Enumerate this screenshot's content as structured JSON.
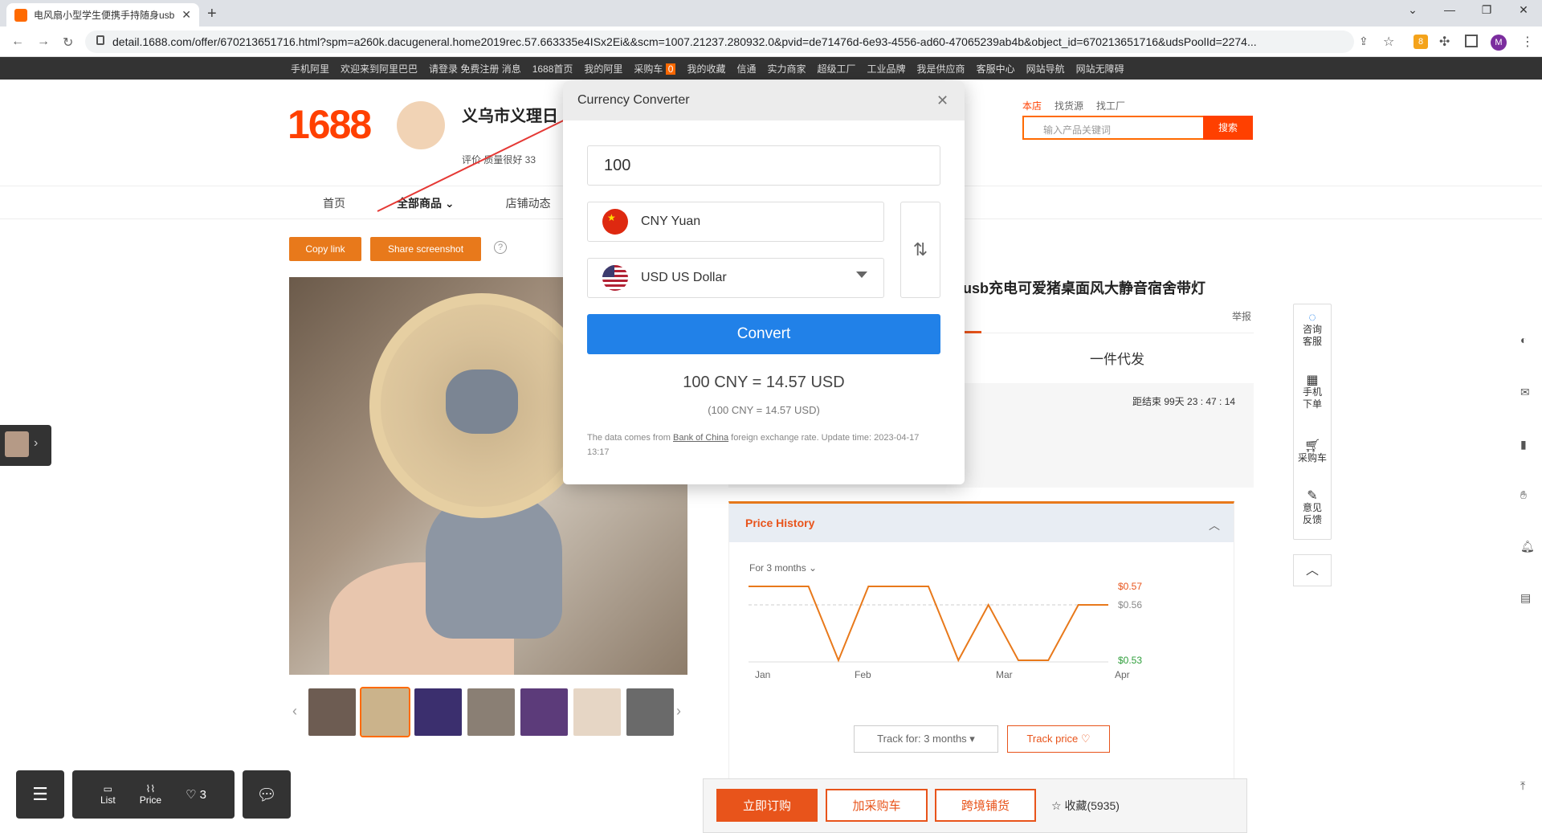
{
  "browser": {
    "tab_title": "电风扇小型学生便携手持随身usb",
    "url": "detail.1688.com/offer/670213651716.html?spm=a260k.dacugeneral.home2019rec.57.663335e4ISx2Ei&&scm=1007.21237.280932.0&pvid=de71476d-6e93-4556-ad60-47065239ab4b&object_id=670213651716&udsPoolId=2274...",
    "ext_badge": "8",
    "profile_initial": "M"
  },
  "site_nav": [
    "手机阿里",
    "欢迎来到阿里巴巴",
    "请登录 免费注册 消息",
    "1688首页",
    "我的阿里",
    "采购车",
    "我的收藏",
    "信通",
    "实力商家",
    "超级工厂",
    "工业品牌",
    "我是供应商",
    "客服中心",
    "网站导航",
    "网站无障碍"
  ],
  "cart_count": "0",
  "header": {
    "logo": "1688",
    "shop_name": "义乌市义理日",
    "shop_meta": "评价  质量很好 33",
    "search_tabs": [
      "本店",
      "找货源",
      "找工厂"
    ],
    "search_placeholder": "输入产品关键词",
    "search_button": "搜索"
  },
  "shop_nav": [
    "首页",
    "全部商品",
    "店铺动态"
  ],
  "actions": {
    "copy_link": "Copy link",
    "share_screenshot": "Share screenshot"
  },
  "product": {
    "title": "usb充电可爱猪桌面风大静音宿舍带灯",
    "report": "举报",
    "dropship": "一件代发",
    "countdown": "距结束  99天 23 : 47 : 14"
  },
  "price_history": {
    "title": "Price History",
    "range_label": "For 3 months",
    "track_for": "Track for: 3 months",
    "track_price": "Track price ♡",
    "y_labels": [
      "$0.57",
      "$0.56",
      "$0.53"
    ],
    "x_labels": [
      "Jan",
      "Feb",
      "Mar",
      "Apr"
    ]
  },
  "chart_data": {
    "type": "line",
    "title": "Price History",
    "x": [
      "Jan",
      "Feb",
      "Mar",
      "Apr"
    ],
    "series": [
      {
        "values": [
          0.57,
          0.57,
          0.57,
          0.53,
          0.57,
          0.57,
          0.57,
          0.53,
          0.56,
          0.53,
          0.53,
          0.56,
          0.56
        ]
      }
    ],
    "ylim": [
      0.53,
      0.57
    ]
  },
  "right_sidebar": [
    "咨询客服",
    "手机下单",
    "采购车",
    "意见反馈"
  ],
  "bottom_bar": {
    "buy_now": "立即订购",
    "add_cart": "加采购车",
    "cross_border": "跨境铺货",
    "favorite": "收藏(5935)"
  },
  "tools": {
    "list": "List",
    "price": "Price",
    "likes": "3"
  },
  "modal": {
    "title": "Currency Converter",
    "amount": "100",
    "from_currency": "CNY Yuan",
    "to_currency": "USD US Dollar",
    "convert_button": "Convert",
    "result_main": "100 CNY = 14.57 USD",
    "result_sub": "(100 CNY = 14.57 USD)",
    "source_prefix": "The data comes from ",
    "source_link": "Bank of China",
    "source_suffix": " foreign exchange rate. Update time: 2023-04-17 13:17"
  }
}
